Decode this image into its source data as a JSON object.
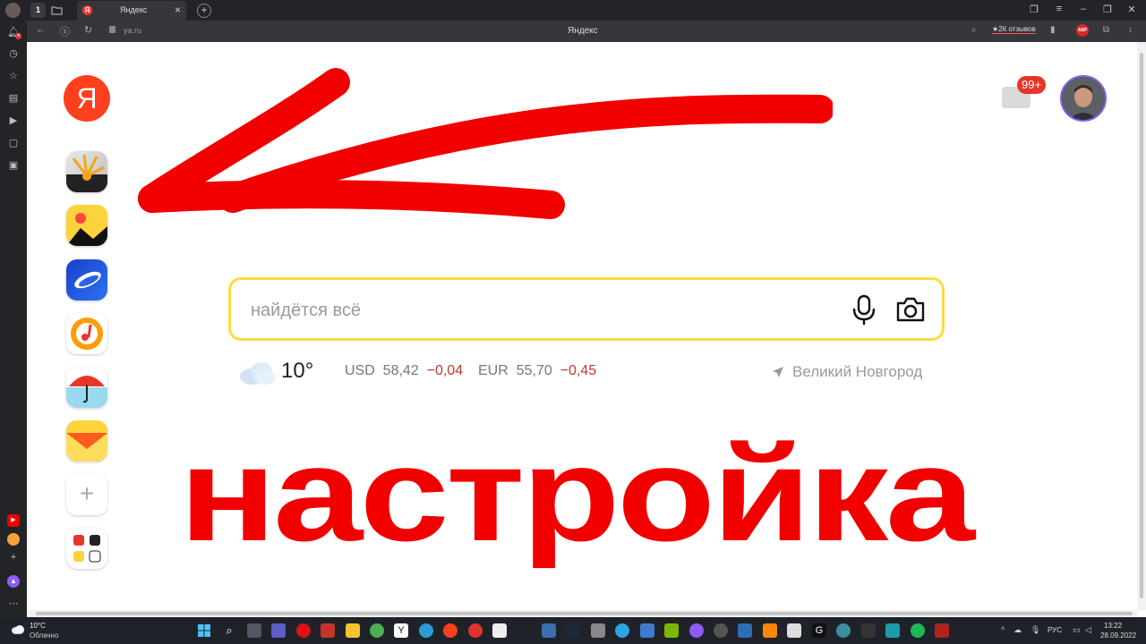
{
  "browser": {
    "tab_number": "1",
    "tab_title": "Яндекс",
    "url": "ya.ru",
    "page_title": "Яндекс",
    "reviews_label": "★2К отзывов",
    "abp_label": "ABP",
    "notification_count": "4"
  },
  "page": {
    "logo_letter": "Я",
    "mail_badge": "99+",
    "search": {
      "placeholder": "найдётся всё"
    },
    "weather": {
      "temperature": "10°"
    },
    "currency": {
      "usd_label": "USD",
      "usd_value": "58,42",
      "usd_change": "−0,04",
      "eur_label": "EUR",
      "eur_value": "55,70",
      "eur_change": "−0,45"
    },
    "city": "Великий Новгород",
    "overlay_text": "настройка",
    "add_service_label": "+"
  },
  "taskbar": {
    "temperature": "10°C",
    "condition": "Облачно",
    "lang": "РУС",
    "time": "13:22",
    "date": "28.09.2022"
  },
  "colors": {
    "yandex_red": "#fc3f1d",
    "search_border": "#fddc3f",
    "overlay_red": "#f20000"
  }
}
